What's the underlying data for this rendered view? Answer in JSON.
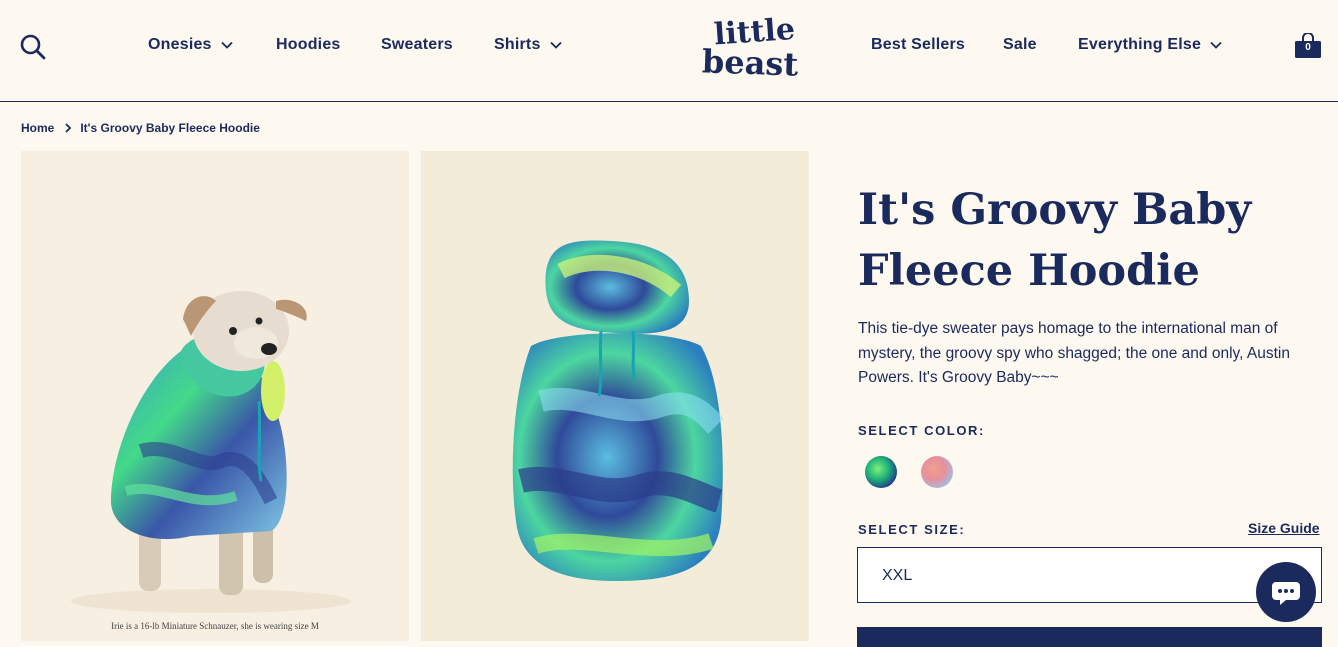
{
  "brand": {
    "logo_text_top": "little",
    "logo_text_bottom": "beast"
  },
  "header": {
    "nav_left": [
      {
        "label": "Onesies",
        "has_dropdown": true
      },
      {
        "label": "Hoodies",
        "has_dropdown": false
      },
      {
        "label": "Sweaters",
        "has_dropdown": false
      },
      {
        "label": "Shirts",
        "has_dropdown": true
      }
    ],
    "nav_right": [
      {
        "label": "Best Sellers",
        "has_dropdown": false
      },
      {
        "label": "Sale",
        "has_dropdown": false
      },
      {
        "label": "Everything Else",
        "has_dropdown": true
      }
    ],
    "cart_count": "0",
    "icons": {
      "search": "search-icon",
      "cart": "shopping-bag-icon"
    }
  },
  "breadcrumb": {
    "home": "Home",
    "current": "It's Groovy Baby Fleece Hoodie"
  },
  "gallery": {
    "image1_caption": "Irie is a 16-lb Miniature Schnauzer, she is wearing size M"
  },
  "product": {
    "title": "It's Groovy Baby Fleece Hoodie",
    "description": "This tie-dye sweater pays homage to the international man of mystery, the groovy spy who shagged; the one and only, Austin Powers. It's Groovy Baby~~~",
    "select_color_label": "SELECT COLOR:",
    "colors": [
      "blue-green tie-dye",
      "pink-blue tie-dye"
    ],
    "select_size_label": "SELECT SIZE:",
    "size_guide_label": "Size Guide",
    "selected_size": "XXL"
  },
  "colors": {
    "navy": "#1b2a5c",
    "background": "#fdf8f0"
  }
}
